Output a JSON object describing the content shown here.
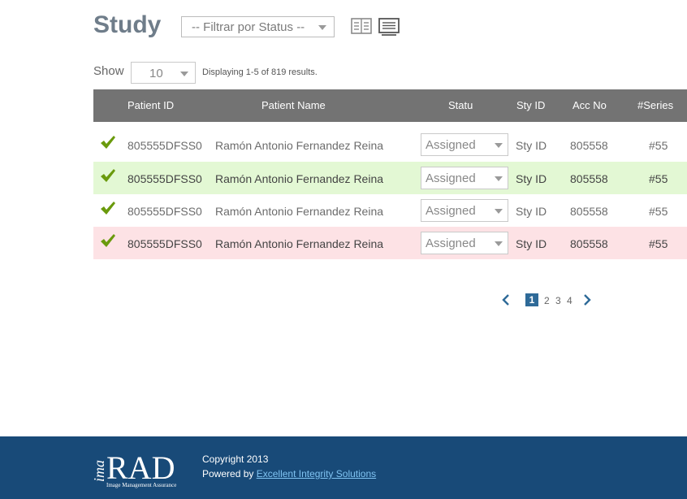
{
  "header": {
    "title": "Study",
    "status_filter": "-- Filtrar por Status --",
    "view_icons": [
      "book-view-icon",
      "list-view-icon"
    ]
  },
  "toolbar": {
    "show_label": "Show",
    "page_size": "10",
    "results_text": "Displaying 1-5 of 819 results."
  },
  "table": {
    "columns": [
      "Patient ID",
      "Patient Name",
      "Statu",
      "Sty ID",
      "Acc No",
      "#Series"
    ],
    "rows": [
      {
        "patient_id": "805555DFSS0",
        "patient_name": "Ramón Antonio Fernandez Reina",
        "status": "Assigned",
        "sty_id": "Sty ID",
        "acc_no": "805558",
        "series": "#55",
        "highlight": "none"
      },
      {
        "patient_id": "805555DFSS0",
        "patient_name": "Ramón Antonio Fernandez Reina",
        "status": "Assigned",
        "sty_id": "Sty ID",
        "acc_no": "805558",
        "series": "#55",
        "highlight": "green"
      },
      {
        "patient_id": "805555DFSS0",
        "patient_name": "Ramón Antonio Fernandez Reina",
        "status": "Assigned",
        "sty_id": "Sty ID",
        "acc_no": "805558",
        "series": "#55",
        "highlight": "none"
      },
      {
        "patient_id": "805555DFSS0",
        "patient_name": "Ramón Antonio Fernandez Reina",
        "status": "Assigned",
        "sty_id": "Sty ID",
        "acc_no": "805558",
        "series": "#55",
        "highlight": "pink"
      }
    ]
  },
  "pagination": {
    "pages": [
      "1",
      "2",
      "3",
      "4"
    ],
    "active_page": "1"
  },
  "footer": {
    "logo_text": "imaRAD",
    "logo_tagline": "Image Management Assurance",
    "copyright": "Copyright 2013",
    "powered_by": "Powered by",
    "company_link": "Excellent Integrity Solutions"
  },
  "colors": {
    "header_bg": "#737373",
    "footer_bg": "#184a78",
    "check": "#6a9a0c",
    "row_green": "#e3f8d4",
    "row_pink": "#fde2e5",
    "page_active": "#2e6a98",
    "link": "#7fc3f2"
  }
}
